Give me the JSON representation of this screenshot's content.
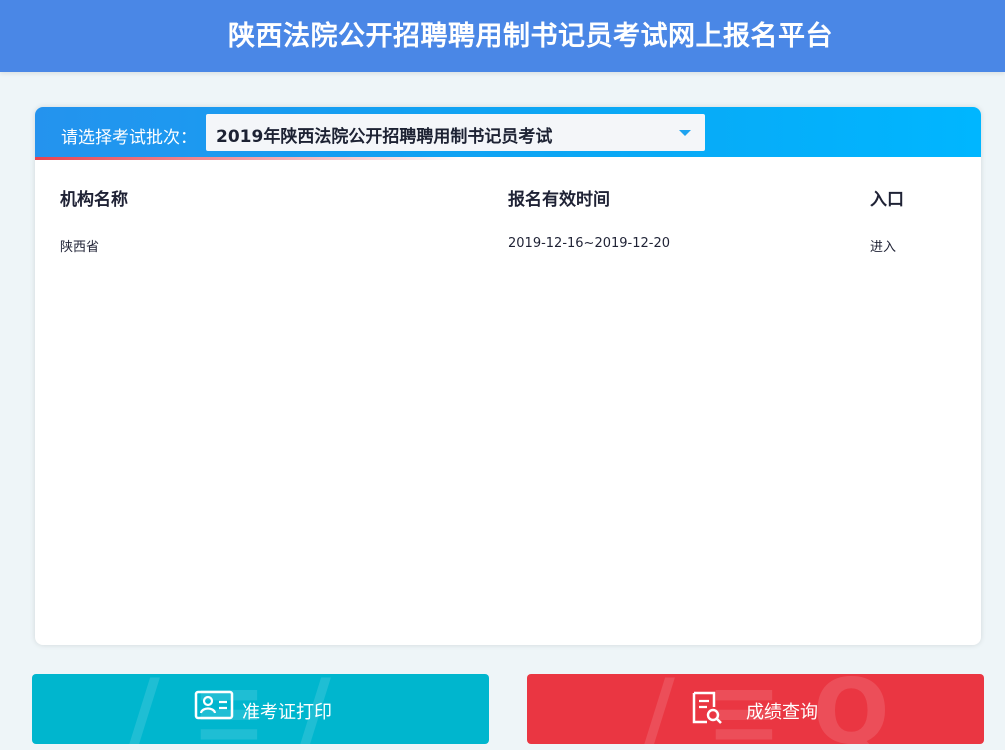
{
  "header": {
    "title": "陕西法院公开招聘聘用制书记员考试网上报名平台"
  },
  "batch": {
    "label": "请选择考试批次：",
    "selected": "2019年陕西法院公开招聘聘用制书记员考试"
  },
  "table": {
    "columns": [
      "机构名称",
      "报名有效时间",
      "入口"
    ],
    "rows": [
      {
        "org": "陕西省",
        "period": "2019-12-16~2019-12-20",
        "entry": "进入"
      }
    ]
  },
  "buttons": {
    "admission_ticket": "准考证打印",
    "score_query": "成绩查询"
  },
  "icons": {
    "admission_ticket": "id-card-icon",
    "score_query": "document-search-icon",
    "select": "caret-down-icon"
  },
  "colors": {
    "header": "#4a87e6",
    "card_bar": "#0aa8f5",
    "cyan_button": "#00b6ce",
    "red_button": "#ea3642"
  }
}
